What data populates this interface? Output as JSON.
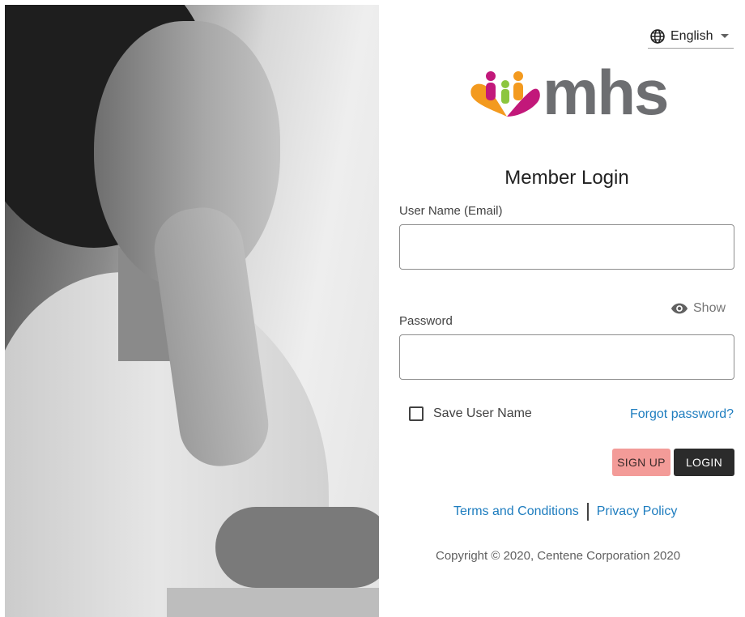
{
  "header": {
    "language_icon": "globe-icon",
    "language": "English",
    "language_caret_icon": "caret-down-icon"
  },
  "brand": {
    "logo_text": "mhs",
    "colors": {
      "wordmark": "#6d6e71",
      "orange": "#f39a1f",
      "green": "#8cc63e",
      "magenta": "#c2187a"
    }
  },
  "form": {
    "title": "Member Login",
    "username_label": "User Name (Email)",
    "username_value": "",
    "password_label": "Password",
    "password_value": "",
    "show_label": "Show",
    "show_icon": "eye-icon",
    "save_username_label": "Save User Name",
    "save_username_checked": false,
    "forgot_password": "Forgot password?",
    "signup_label": "SIGN UP",
    "login_label": "LOGIN"
  },
  "footer": {
    "terms": "Terms and Conditions",
    "privacy": "Privacy Policy",
    "copyright": "Copyright © 2020, Centene Corporation 2020"
  },
  "colors": {
    "link": "#1e7dbf",
    "signup_bg": "#f39b98",
    "login_bg": "#2b2b2b"
  }
}
